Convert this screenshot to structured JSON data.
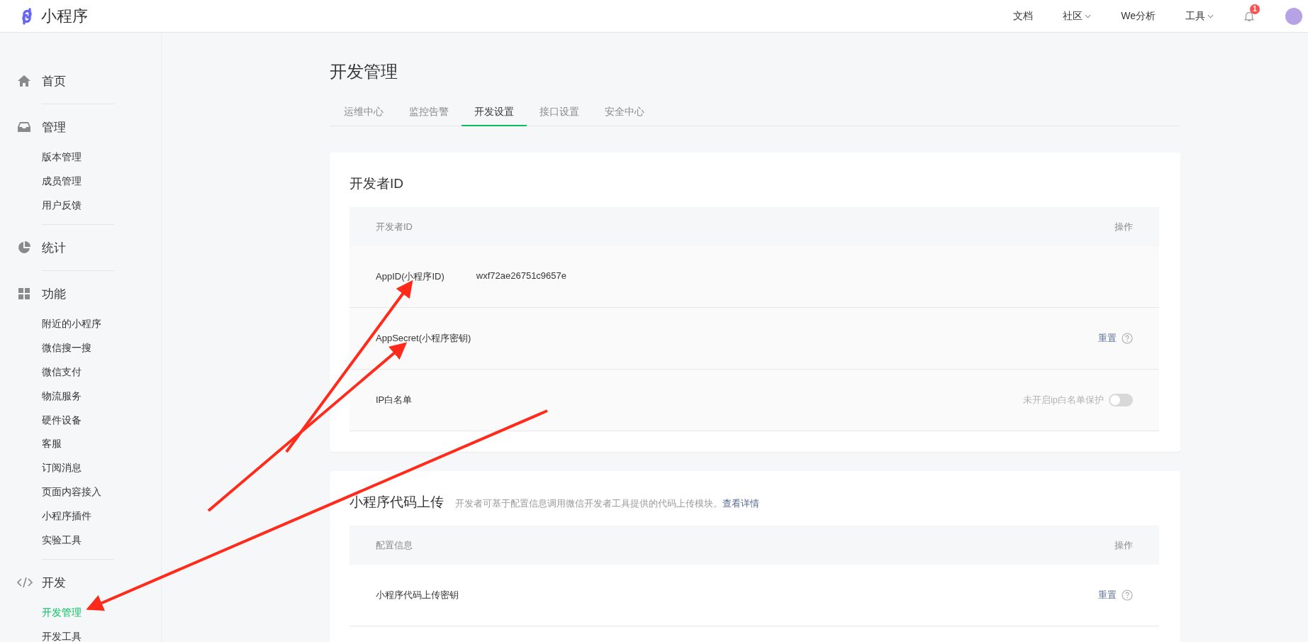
{
  "top_bar": {
    "title": "小程序",
    "nav": [
      {
        "label": "文档",
        "dropdown": false
      },
      {
        "label": "社区",
        "dropdown": true
      },
      {
        "label": "We分析",
        "dropdown": false
      },
      {
        "label": "工具",
        "dropdown": true
      }
    ],
    "notification_badge": "1"
  },
  "sidebar": {
    "sections": [
      {
        "label": "首页"
      },
      {
        "label": "管理",
        "items": [
          {
            "label": "版本管理",
            "selected": false
          },
          {
            "label": "成员管理",
            "selected": false
          },
          {
            "label": "用户反馈",
            "selected": false
          }
        ]
      },
      {
        "label": "统计"
      },
      {
        "label": "功能",
        "items": [
          {
            "label": "附近的小程序",
            "selected": false
          },
          {
            "label": "微信搜一搜",
            "selected": false
          },
          {
            "label": "微信支付",
            "selected": false
          },
          {
            "label": "物流服务",
            "selected": false
          },
          {
            "label": "硬件设备",
            "selected": false
          },
          {
            "label": "客服",
            "selected": false
          },
          {
            "label": "订阅消息",
            "selected": false
          },
          {
            "label": "页面内容接入",
            "selected": false
          },
          {
            "label": "小程序插件",
            "selected": false
          },
          {
            "label": "实验工具",
            "selected": false
          }
        ]
      },
      {
        "label": "开发",
        "items": [
          {
            "label": "开发管理",
            "selected": true
          },
          {
            "label": "开发工具",
            "selected": false
          }
        ]
      }
    ]
  },
  "page": {
    "title": "开发管理",
    "tabs": [
      {
        "label": "运维中心",
        "selected": false
      },
      {
        "label": "监控告警",
        "selected": false
      },
      {
        "label": "开发设置",
        "selected": true
      },
      {
        "label": "接口设置",
        "selected": false
      },
      {
        "label": "安全中心",
        "selected": false
      }
    ]
  },
  "cards": [
    {
      "title": "开发者ID",
      "columns": [
        "开发者ID",
        "操作"
      ],
      "rows": [
        {
          "kind": "value",
          "label": "AppID(小程序ID)",
          "value": "wxf72ae26751c9657e"
        },
        {
          "kind": "reset",
          "label": "AppSecret(小程序密钥)",
          "action": "重置"
        },
        {
          "kind": "toggle",
          "label": "IP白名单",
          "status": "未开启ip白名单保护",
          "on": false
        }
      ]
    },
    {
      "title": "小程序代码上传",
      "description": "开发者可基于配置信息调用微信开发者工具提供的代码上传模块。",
      "link": "查看详情",
      "columns": [
        "配置信息",
        "操作"
      ],
      "rows": [
        {
          "kind": "reset",
          "label": "小程序代码上传密钥",
          "action": "重置"
        }
      ]
    }
  ]
}
